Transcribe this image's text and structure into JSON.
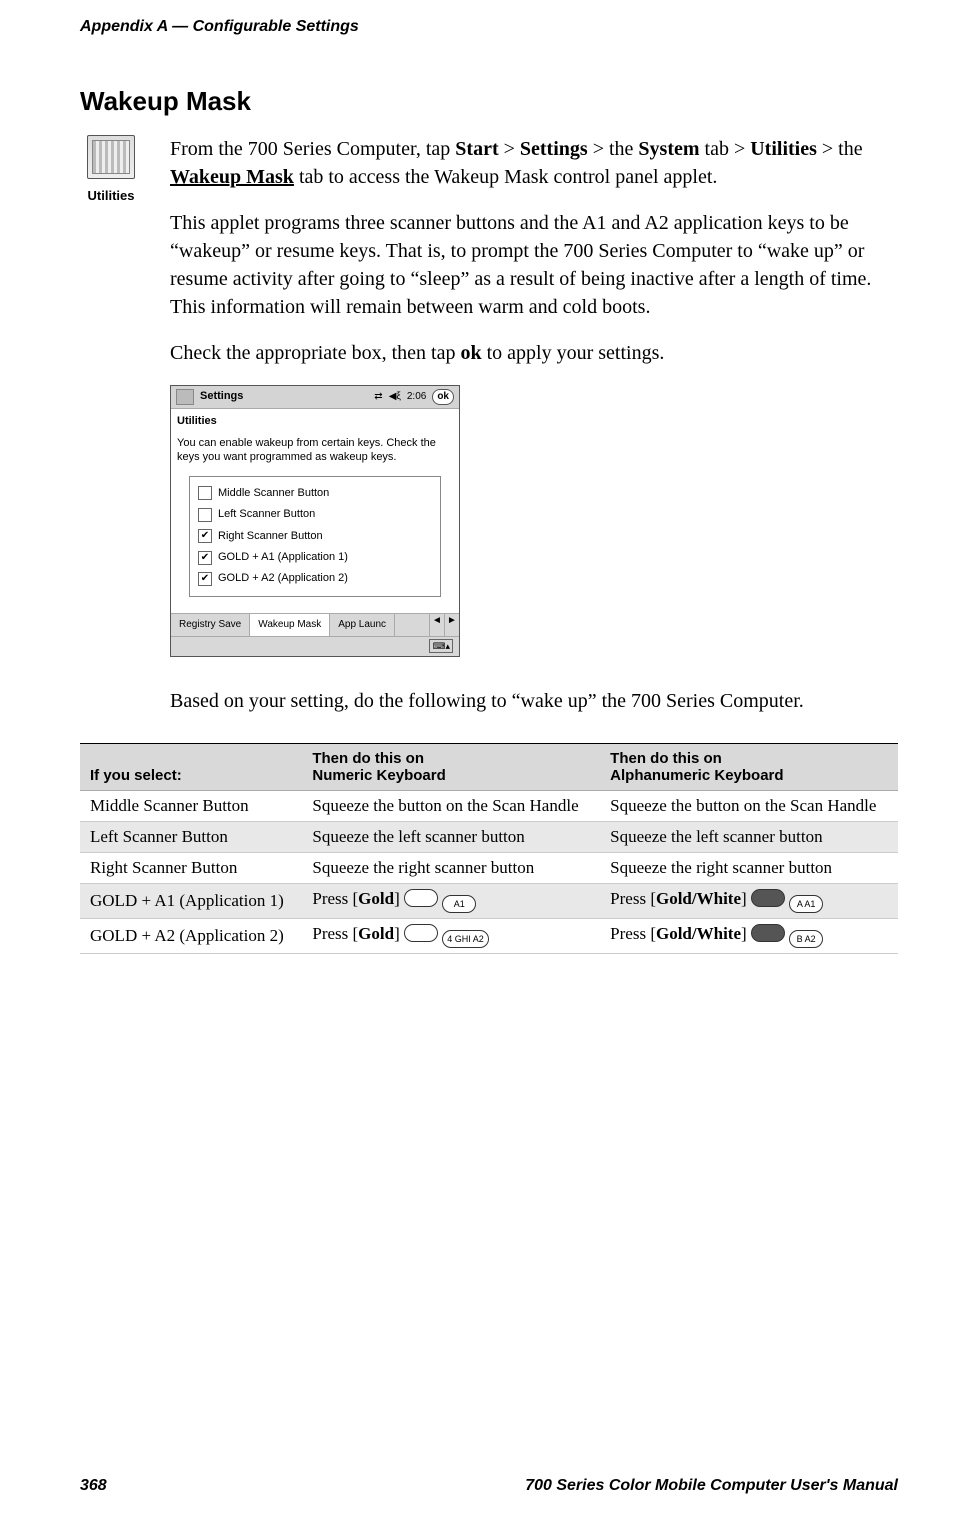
{
  "page": {
    "running_head": "Appendix  A   —   Configurable Settings",
    "page_number": "368",
    "manual_title": "700 Series Color Mobile Computer User's Manual"
  },
  "heading": "Wakeup Mask",
  "icon": {
    "label": "Utilities"
  },
  "paras": {
    "p1_a": "From the 700 Series Computer, tap ",
    "p1_start": "Start",
    "p1_gt1": " > ",
    "p1_settings": "Settings",
    "p1_gt2": " > the ",
    "p1_system": "System",
    "p1_b": " tab > ",
    "p1_utilities": "Utilities",
    "p1_c": " > the ",
    "p1_wakeup": "Wakeup Mask",
    "p1_d": " tab to access the Wakeup Mask control panel applet.",
    "p2": "This applet programs three scanner buttons and the A1 and A2 application keys to be “wakeup” or resume keys. That is, to prompt the 700 Series Computer to “wake up” or resume activity after going to “sleep” as a result of being inactive after a length of time. This information will remain between warm and cold boots.",
    "p3_a": "Check the appropriate box, then tap ",
    "p3_ok": "ok",
    "p3_b": " to apply your settings.",
    "p4": "Based on your setting, do the following to “wake up” the 700 Series Computer."
  },
  "screenshot": {
    "title": "Settings",
    "time": "2:06",
    "ok": "ok",
    "subtitle": "Utilities",
    "desc": "You can enable wakeup from certain keys. Check the keys you want programmed as wakeup keys.",
    "items": [
      {
        "label": "Middle Scanner Button",
        "checked": false
      },
      {
        "label": "Left Scanner Button",
        "checked": false
      },
      {
        "label": "Right Scanner Button",
        "checked": true
      },
      {
        "label": "GOLD + A1 (Application 1)",
        "checked": true
      },
      {
        "label": "GOLD + A2 (Application 2)",
        "checked": true
      }
    ],
    "tabs": [
      "Registry Save",
      "Wakeup Mask",
      "App Launc"
    ],
    "sip": "⌨▴"
  },
  "table": {
    "headers": {
      "c1": "If you select:",
      "c2a": "Then do this on",
      "c2b": "Numeric Keyboard",
      "c3a": "Then do this on",
      "c3b": "Alphanumeric Keyboard"
    },
    "rows": [
      {
        "c1": "Middle Scanner Button",
        "c2": "Squeeze the button on the Scan Handle",
        "c3": "Squeeze the button on the Scan Handle",
        "alt": false
      },
      {
        "c1": "Left Scanner Button",
        "c2": "Squeeze the left scanner button",
        "c3": "Squeeze the left scanner button",
        "alt": true
      },
      {
        "c1": "Right Scanner Button",
        "c2": "Squeeze the right scanner button",
        "c3": "Squeeze the right scanner button",
        "alt": false
      },
      {
        "c1": "GOLD + A1 (Application 1)",
        "c2_pre": "Press [",
        "c2_bold": "Gold",
        "c2_post": "] ",
        "c2_key2": "A1",
        "c3_pre": "Press [",
        "c3_bold": "Gold/White",
        "c3_post": "] ",
        "c3_key2": "A A1",
        "alt": true,
        "keys": true
      },
      {
        "c1": "GOLD + A2 (Application 2)",
        "c2_pre": "Press [",
        "c2_bold": "Gold",
        "c2_post": "] ",
        "c2_key2": "4 GHI A2",
        "c3_pre": "Press [",
        "c3_bold": "Gold/White",
        "c3_post": "] ",
        "c3_key2": "B A2",
        "alt": false,
        "keys": true
      }
    ]
  }
}
